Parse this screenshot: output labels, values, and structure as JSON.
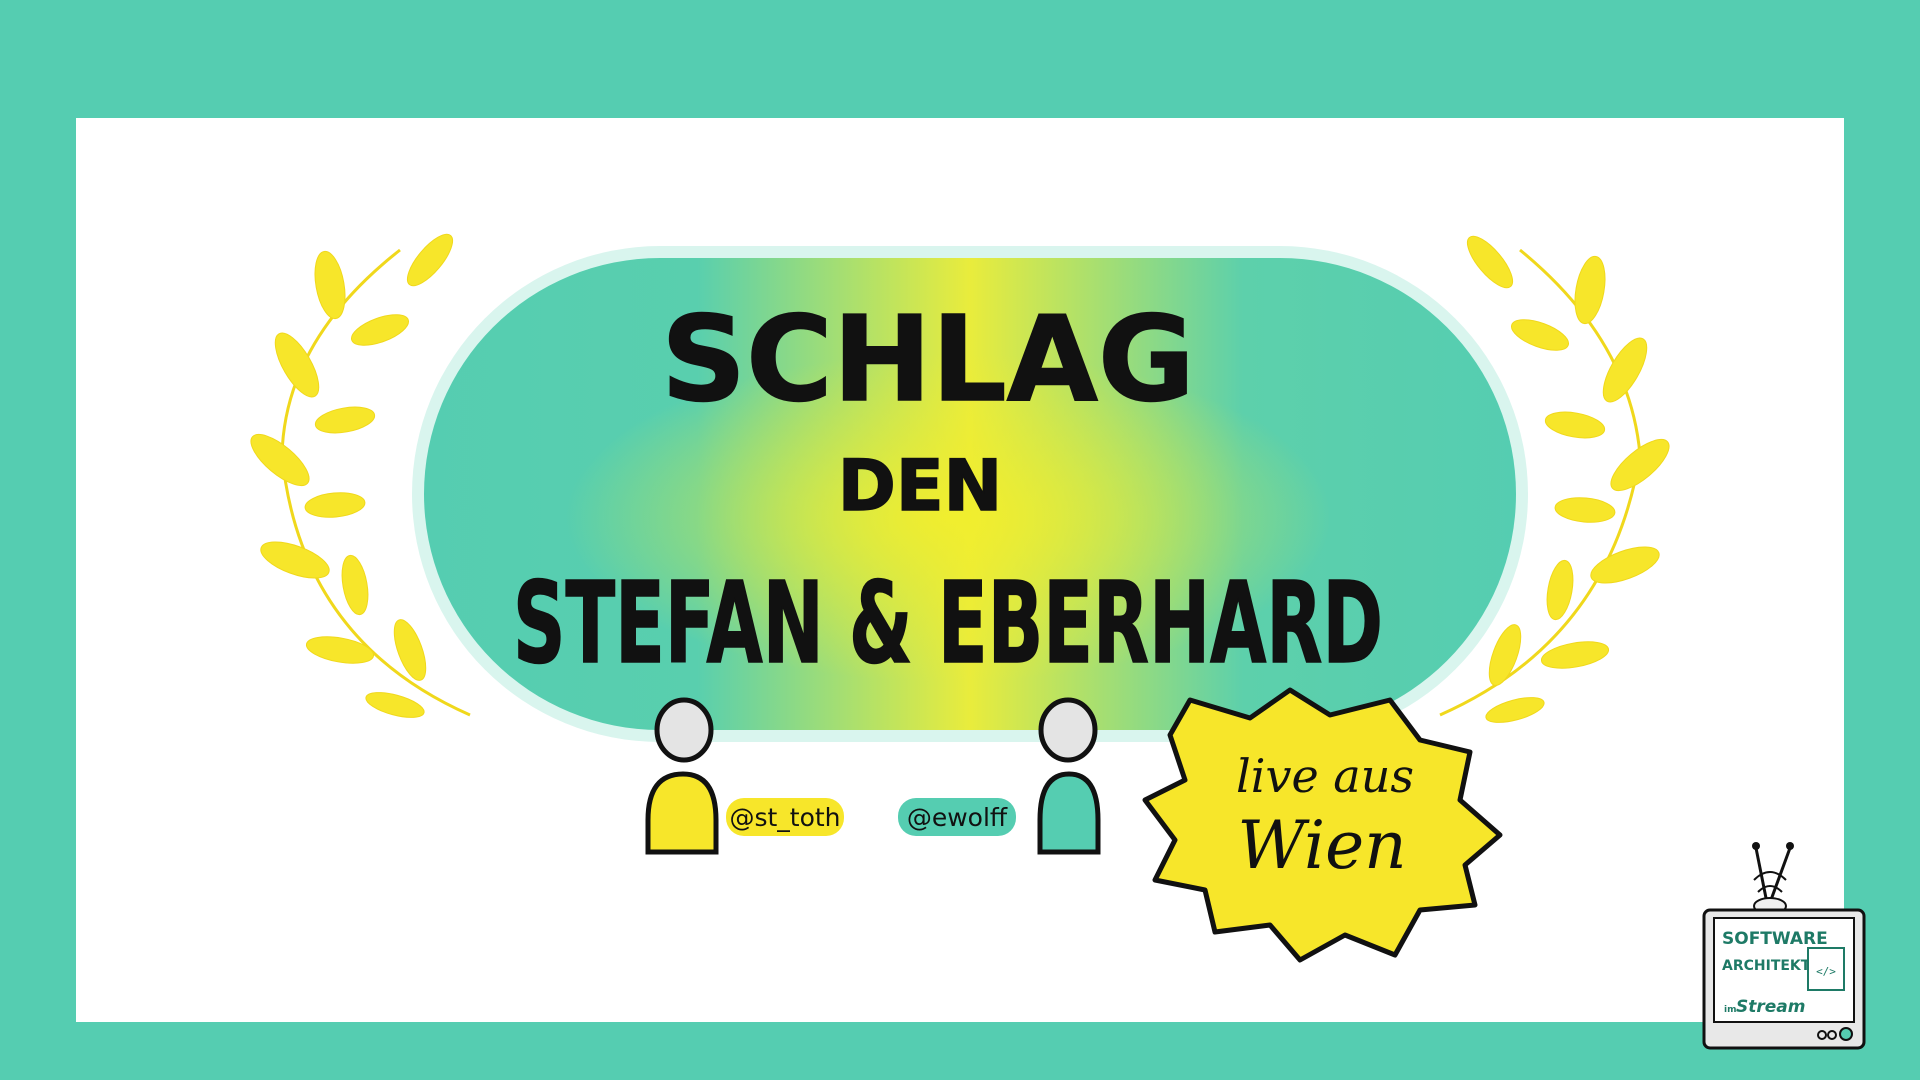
{
  "title": {
    "line1": "SCHLAG",
    "line2": "DEN",
    "line3": "STEFAN & EBERHARD"
  },
  "people": [
    {
      "handle": "@st_toth",
      "color": "#f7e62a"
    },
    {
      "handle": "@ewolff",
      "color": "#55cdb1"
    }
  ],
  "badge": {
    "line1": "live aus",
    "line2": "Wien",
    "color": "#f7e62a"
  },
  "logo": {
    "line1": "SOFTWARE",
    "line2": "ARCHITEKTUR",
    "line3": "im",
    "line4": "Stream",
    "code_glyph": "</>"
  },
  "colors": {
    "frame": "#55cdb1",
    "card": "#ffffff",
    "laurel": "#f7e62a",
    "pill_start": "#55cdb1",
    "pill_center": "#eded33"
  },
  "icons": [
    "laurel-left-icon",
    "laurel-right-icon",
    "person-icon",
    "tv-icon"
  ]
}
